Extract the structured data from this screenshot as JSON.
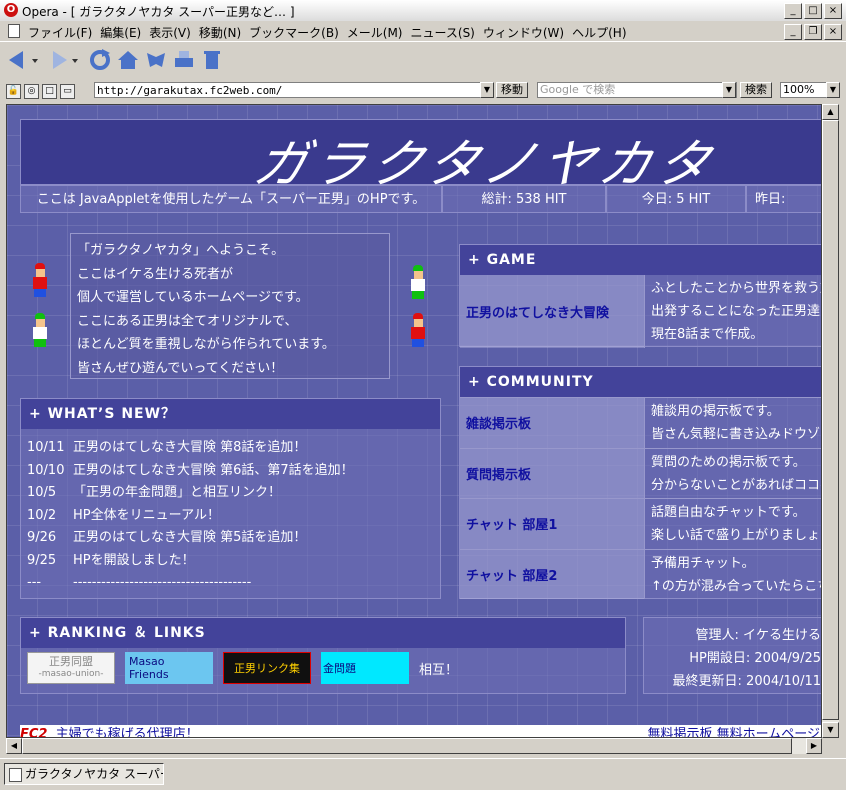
{
  "window": {
    "title": "Opera - [ ガラクタノヤカタ スーパー正男など… ]",
    "app_letter": "O",
    "btn_min": "_",
    "btn_max": "□",
    "btn_close": "×",
    "mdi_min": "_",
    "mdi_restore": "❐",
    "mdi_close": "×"
  },
  "menu": {
    "items": [
      "ファイル(F)",
      "編集(E)",
      "表示(V)",
      "移動(N)",
      "ブックマーク(B)",
      "メール(M)",
      "ニュース(S)",
      "ウィンドウ(W)",
      "ヘルプ(H)"
    ]
  },
  "address": {
    "url": "http://garakutax.fc2web.com/",
    "go_label": "移動",
    "search_placeholder": "Google で検索",
    "search_label": "検索",
    "zoom": "100%"
  },
  "page": {
    "logo_text": "ガラクタノヤカタ",
    "info": {
      "desc": "ここは JavaAppletを使用したゲーム「スーパー正男」のHPです。",
      "total": "総計: 538 HIT",
      "today": "今日: 5 HIT",
      "yesterday": "昨日:"
    },
    "welcome": [
      "「ガラクタノヤカタ」へようこそ。",
      "ここはイケる生ける死者が",
      "個人で運営しているホームページです。",
      "ここにある正男は全てオリジナルで、",
      "ほとんど質を重視しながら作られています。",
      "皆さんぜひ遊んでいってください！"
    ],
    "whats_new": {
      "title": "+ WHAT’S NEW？",
      "items": [
        {
          "date": "10/11",
          "text": "正男のはてしなき大冒険 第8話を追加！"
        },
        {
          "date": "10/10",
          "text": "正男のはてしなき大冒険 第6話、第7話を追加！"
        },
        {
          "date": "10/5",
          "text": "「正男の年金問題」と相互リンク！"
        },
        {
          "date": "10/2",
          "text": "HP全体をリニューアル！"
        },
        {
          "date": "9/26",
          "text": "正男のはてしなき大冒険 第5話を追加！"
        },
        {
          "date": "9/25",
          "text": "HPを開設しました！"
        },
        {
          "date": "---",
          "text": "--------------------------------------"
        }
      ]
    },
    "game": {
      "title": "+ GAME",
      "name": "正男のはてしなき大冒険",
      "desc": [
        "ふとしたことから世界を救う旅に",
        "出発することになった正男達",
        "現在8話まで作成。"
      ]
    },
    "community": {
      "title": "+ COMMUNITY",
      "rows": [
        {
          "name": "雑談掲示板",
          "desc": [
            "雑談用の掲示板です。",
            "皆さん気軽に書き込みドウゾ"
          ]
        },
        {
          "name": "質問掲示板",
          "desc": [
            "質問のための掲示板です。",
            "分からないことがあればココへ"
          ]
        },
        {
          "name": "チャット 部屋1",
          "desc": [
            "話題自由なチャットです。",
            "楽しい話で盛り上がりましょう"
          ]
        },
        {
          "name": "チャット 部屋2",
          "desc": [
            "予備用チャット。",
            "↑の方が混み合っていたらこちら"
          ]
        }
      ]
    },
    "ranking": {
      "title": "+ RANKING ＆ LINKS",
      "banner1_line1": "正男同盟",
      "banner1_line2": "-masao-union-",
      "banner2_line1": "Masao",
      "banner2_line2": "Friends",
      "banner3": "正男リンク集",
      "banner4": "金問題",
      "mutual": "相互！"
    },
    "admin": {
      "manager": "管理人: イケる生ける",
      "opened": "HP開設日: 2004/9/25",
      "updated": "最終更新日: 2004/10/11"
    },
    "fc2": {
      "logo": "FC2",
      "ad": "主婦でも稼げる代理店！",
      "right": "無料掲示板 無料ホームページ"
    }
  },
  "taskbar": {
    "item": "ガラクタノヤカタ スーパー..."
  },
  "colors": {
    "page_bg": "#5b5fa8",
    "header_bg": "#43439a",
    "link": "#1010a0"
  }
}
